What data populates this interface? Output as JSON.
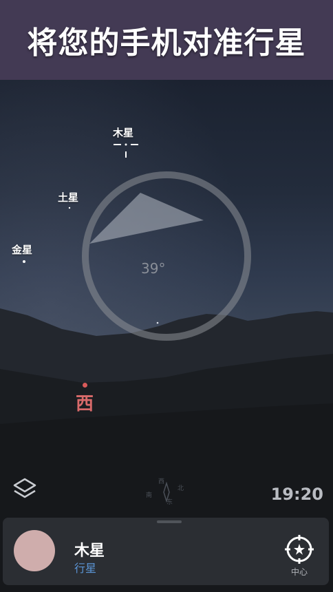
{
  "banner": {
    "title": "将您的手机对准行星"
  },
  "sky": {
    "labels": {
      "jupiter": "木星",
      "saturn": "土星",
      "venus": "金星"
    },
    "compass_degree": "39°",
    "direction": "西"
  },
  "mini_compass": {
    "north": "北",
    "south": "南",
    "east": "东",
    "west": "西"
  },
  "status": {
    "time": "19:20"
  },
  "selected_object": {
    "name": "木星",
    "type": "行星"
  },
  "center_button": {
    "label": "中心"
  },
  "colors": {
    "banner_bg": "#433a54",
    "direction_red": "#d86a6a",
    "subtitle_blue": "#5b95d6",
    "planet_avatar": "#cfadac"
  },
  "icons": {
    "layers": "layers-icon",
    "center": "crosshair-icon",
    "compass": "compass-icon"
  }
}
